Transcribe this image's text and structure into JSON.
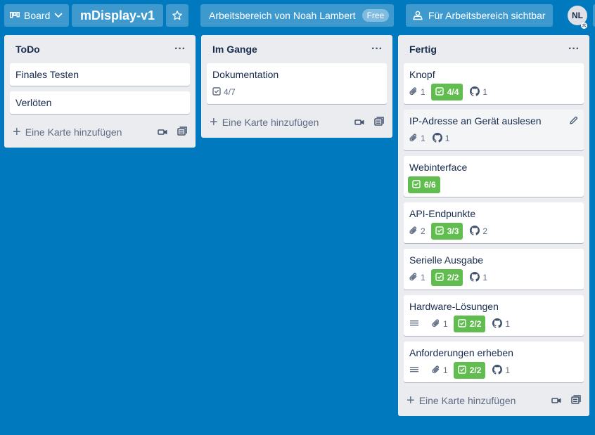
{
  "header": {
    "view_label": "Board",
    "board_title": "mDisplay-v1",
    "workspace_label": "Arbeitsbereich von Noah Lambert",
    "workspace_badge": "Free",
    "visibility_label": "Für Arbeitsbereich sichtbar",
    "avatar_initials": "NL"
  },
  "lists": [
    {
      "title": "ToDo",
      "add_label": "Eine Karte hinzufügen",
      "cards": [
        {
          "title": "Finales Testen"
        },
        {
          "title": "Verlöten"
        }
      ]
    },
    {
      "title": "Im Gange",
      "add_label": "Eine Karte hinzufügen",
      "cards": [
        {
          "title": "Dokumentation",
          "checklist": "4/7"
        }
      ]
    },
    {
      "title": "Fertig",
      "add_label": "Eine Karte hinzufügen",
      "cards": [
        {
          "title": "Knopf",
          "attachments": "1",
          "checklist": "4/4",
          "github": "1"
        },
        {
          "title": "IP-Adresse an Gerät auslesen",
          "attachments": "1",
          "github": "1"
        },
        {
          "title": "Webinterface",
          "checklist": "6/6"
        },
        {
          "title": "API-Endpunkte",
          "attachments": "2",
          "checklist": "3/3",
          "github": "2"
        },
        {
          "title": "Serielle Ausgabe",
          "attachments": "1",
          "checklist": "2/2",
          "github": "1"
        },
        {
          "title": "Hardware-Lösungen",
          "attachments": "1",
          "checklist": "2/2",
          "github": "1"
        },
        {
          "title": "Anforderungen erheben",
          "attachments": "1",
          "checklist": "2/2",
          "github": "1"
        }
      ]
    }
  ],
  "colors": {
    "background": "#0079bf",
    "list_bg": "#ebecf0",
    "checklist_complete": "#61bd4f"
  }
}
